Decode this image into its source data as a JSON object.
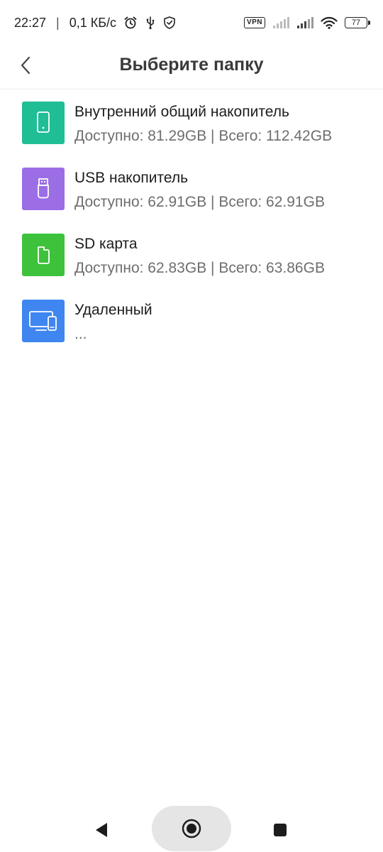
{
  "status_bar": {
    "time": "22:27",
    "separator": "|",
    "net_speed": "0,1 КБ/с",
    "vpn_label": "VPN",
    "battery": "77",
    "icons": [
      "alarm-icon",
      "usb-icon",
      "shield-check-icon",
      "signal-icon",
      "signal-icon",
      "wifi-icon",
      "battery-icon"
    ]
  },
  "header": {
    "title": "Выберите папку",
    "back_icon": "chevron-left-icon"
  },
  "storage": {
    "items": [
      {
        "name": "Внутренний общий накопитель",
        "info": "Доступно: 81.29GB | Всего: 112.42GB",
        "icon": "phone-icon",
        "color": "#1fbe94"
      },
      {
        "name": "USB накопитель",
        "info": "Доступно: 62.91GB | Всего: 62.91GB",
        "icon": "usb-drive-icon",
        "color": "#9b6ee6"
      },
      {
        "name": "SD карта",
        "info": "Доступно: 62.83GB | Всего: 63.86GB",
        "icon": "sd-card-icon",
        "color": "#3ec23c"
      },
      {
        "name": "Удаленный",
        "info": "...",
        "icon": "remote-devices-icon",
        "color": "#3f86f0"
      }
    ]
  },
  "nav_bar": {
    "icons": [
      "nav-back-icon",
      "nav-home-icon",
      "nav-recents-icon"
    ],
    "pill_color": "#e5e5e5"
  }
}
